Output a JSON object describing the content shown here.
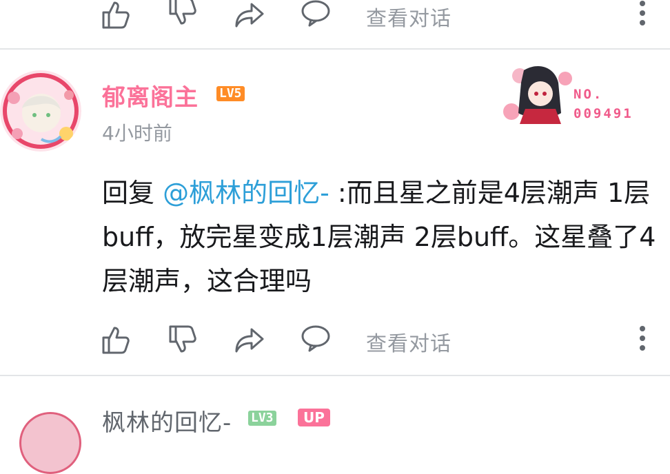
{
  "colors": {
    "accent": "#fb7299",
    "mention": "#2d9fd8",
    "muted": "#9499a0",
    "divider": "#e3e5e7",
    "level": "#ff8c26"
  },
  "top_actions": {
    "view_conversation": "查看对话"
  },
  "comment": {
    "username": "郁离阁主",
    "level_badge": "LV5",
    "time": "4小时前",
    "fan_card": {
      "label": "NO.",
      "number": "009491"
    },
    "reply_prefix": "回复 ",
    "mention": "@枫林的回忆-",
    "body": " :而且星之前是4层潮声 1层buff，放完星变成1层潮声  2层buff。这星叠了4层潮声，这合理吗",
    "actions": {
      "like_icon": "thumbs-up-icon",
      "dislike_icon": "thumbs-down-icon",
      "share_icon": "share-icon",
      "reply_icon": "comment-bubble-icon",
      "view_conversation": "查看对话",
      "more_icon": "more-vertical-icon"
    }
  },
  "next_comment": {
    "username": "枫林的回忆-",
    "level_badge": "LV3",
    "up_badge": "UP"
  }
}
